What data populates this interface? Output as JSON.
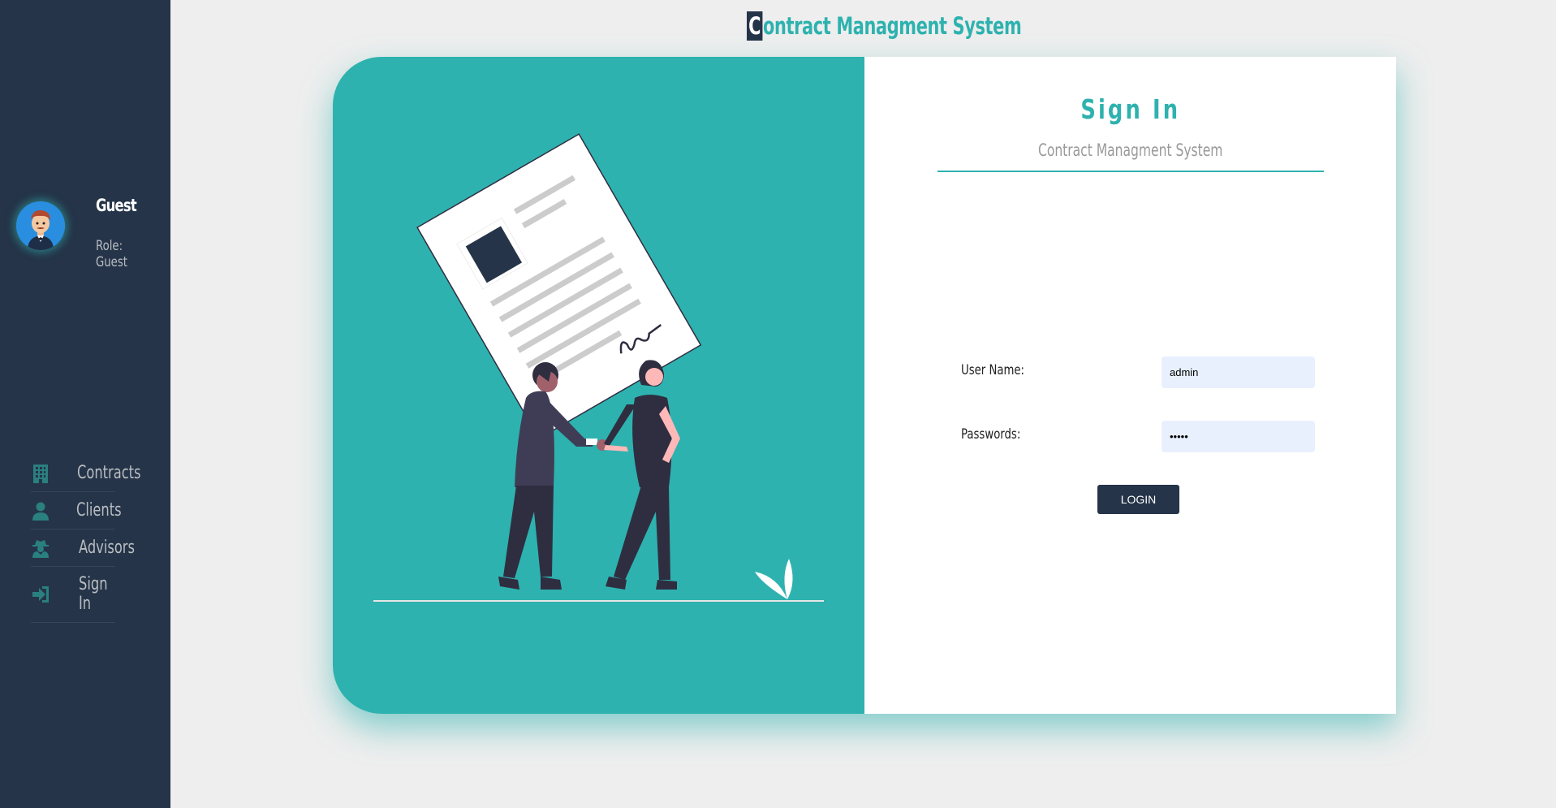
{
  "app": {
    "title_first_letter": "C",
    "title_rest": "ontract Managment System"
  },
  "user": {
    "name": "Guest",
    "role": "Role: Guest"
  },
  "nav": {
    "items": [
      {
        "label": "Contracts",
        "icon": "building-icon"
      },
      {
        "label": "Clients",
        "icon": "user-icon"
      },
      {
        "label": "Advisors",
        "icon": "user-secret-icon"
      },
      {
        "label": "Sign In",
        "icon": "sign-in-icon"
      }
    ]
  },
  "signin": {
    "title": "Sign In",
    "subtitle": "Contract Managment System",
    "username_label": "User Name:",
    "username_value": "admin",
    "password_label": "Passwords:",
    "password_value": "admin",
    "login_label": "LOGIN"
  },
  "colors": {
    "sidebar": "#253448",
    "accent": "#2eb2af",
    "input_bg": "#e8f0fe",
    "background": "#eeeeee"
  }
}
